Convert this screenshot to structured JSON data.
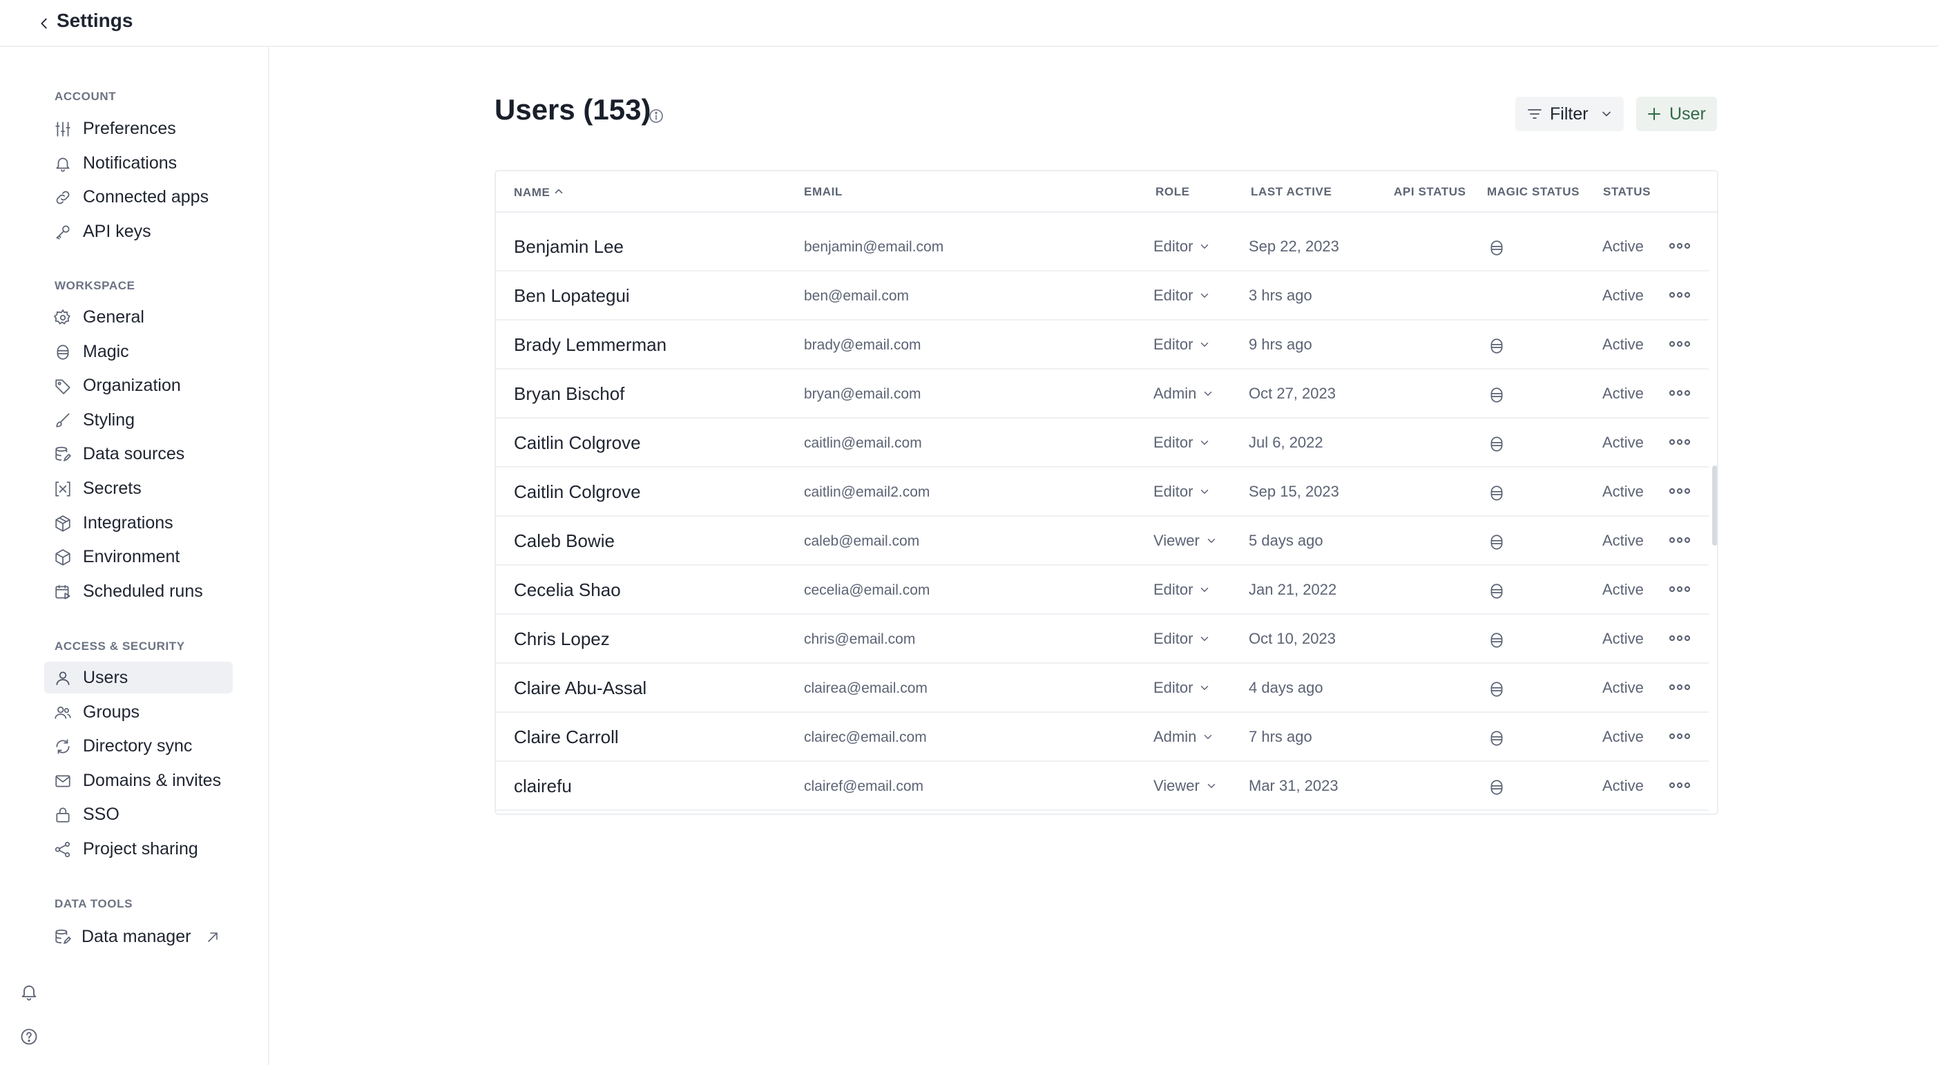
{
  "topbar": {
    "title": "Settings"
  },
  "sidebar": {
    "sections": [
      {
        "label": "ACCOUNT",
        "items": [
          {
            "label": "Preferences",
            "icon": "sliders-icon"
          },
          {
            "label": "Notifications",
            "icon": "bell-icon"
          },
          {
            "label": "Connected apps",
            "icon": "link-icon"
          },
          {
            "label": "API keys",
            "icon": "key-icon"
          }
        ]
      },
      {
        "label": "WORKSPACE",
        "items": [
          {
            "label": "General",
            "icon": "gear-icon"
          },
          {
            "label": "Magic",
            "icon": "magic-icon"
          },
          {
            "label": "Organization",
            "icon": "tag-icon"
          },
          {
            "label": "Styling",
            "icon": "brush-icon"
          },
          {
            "label": "Data sources",
            "icon": "database-edit-icon"
          },
          {
            "label": "Secrets",
            "icon": "variable-icon"
          },
          {
            "label": "Integrations",
            "icon": "package-icon"
          },
          {
            "label": "Environment",
            "icon": "cube-icon"
          },
          {
            "label": "Scheduled runs",
            "icon": "calendar-play-icon"
          }
        ]
      },
      {
        "label": "ACCESS & SECURITY",
        "items": [
          {
            "label": "Users",
            "icon": "user-icon",
            "active": true
          },
          {
            "label": "Groups",
            "icon": "users-icon"
          },
          {
            "label": "Directory sync",
            "icon": "sync-icon"
          },
          {
            "label": "Domains & invites",
            "icon": "mail-icon"
          },
          {
            "label": "SSO",
            "icon": "lock-icon"
          },
          {
            "label": "Project sharing",
            "icon": "share-icon"
          }
        ]
      },
      {
        "label": "DATA TOOLS",
        "items": [
          {
            "label": "Data manager",
            "icon": "database-edit-icon",
            "external": true
          }
        ]
      }
    ]
  },
  "main": {
    "title": "Users (153)",
    "filter_label": "Filter",
    "add_user_label": "User",
    "columns": [
      "NAME",
      "EMAIL",
      "ROLE",
      "LAST ACTIVE",
      "API STATUS",
      "MAGIC STATUS",
      "STATUS"
    ],
    "rows": [
      {
        "name": "Benjamin Lee",
        "email": "benjamin@email.com",
        "role": "Editor",
        "last_active": "Sep 22, 2023",
        "magic": true,
        "status": "Active"
      },
      {
        "name": "Ben Lopategui",
        "email": "ben@email.com",
        "role": "Editor",
        "last_active": "3 hrs ago",
        "magic": false,
        "status": "Active"
      },
      {
        "name": "Brady Lemmerman",
        "email": "brady@email.com",
        "role": "Editor",
        "last_active": "9 hrs ago",
        "magic": true,
        "status": "Active"
      },
      {
        "name": "Bryan Bischof",
        "email": "bryan@email.com",
        "role": "Admin",
        "last_active": "Oct 27, 2023",
        "magic": true,
        "status": "Active"
      },
      {
        "name": "Caitlin Colgrove",
        "email": "caitlin@email.com",
        "role": "Editor",
        "last_active": "Jul 6, 2022",
        "magic": true,
        "status": "Active"
      },
      {
        "name": "Caitlin Colgrove",
        "email": "caitlin@email2.com",
        "role": "Editor",
        "last_active": "Sep 15, 2023",
        "magic": true,
        "status": "Active"
      },
      {
        "name": "Caleb Bowie",
        "email": "caleb@email.com",
        "role": "Viewer",
        "last_active": "5 days ago",
        "magic": true,
        "status": "Active"
      },
      {
        "name": "Cecelia Shao",
        "email": "cecelia@email.com",
        "role": "Editor",
        "last_active": "Jan 21, 2022",
        "magic": true,
        "status": "Active"
      },
      {
        "name": "Chris Lopez",
        "email": "chris@email.com",
        "role": "Editor",
        "last_active": "Oct 10, 2023",
        "magic": true,
        "status": "Active"
      },
      {
        "name": "Claire Abu-Assal",
        "email": "clairea@email.com",
        "role": "Editor",
        "last_active": "4 days ago",
        "magic": true,
        "status": "Active"
      },
      {
        "name": "Claire Carroll",
        "email": "clairec@email.com",
        "role": "Admin",
        "last_active": "7 hrs ago",
        "magic": true,
        "status": "Active"
      },
      {
        "name": "clairefu",
        "email": "clairef@email.com",
        "role": "Viewer",
        "last_active": "Mar 31, 2023",
        "magic": true,
        "status": "Active"
      }
    ]
  },
  "colors": {
    "accent_green": "#2f6b45",
    "active_nav_bg": "#eef0f4",
    "border": "#eceef2",
    "muted_text": "#5c6374"
  }
}
